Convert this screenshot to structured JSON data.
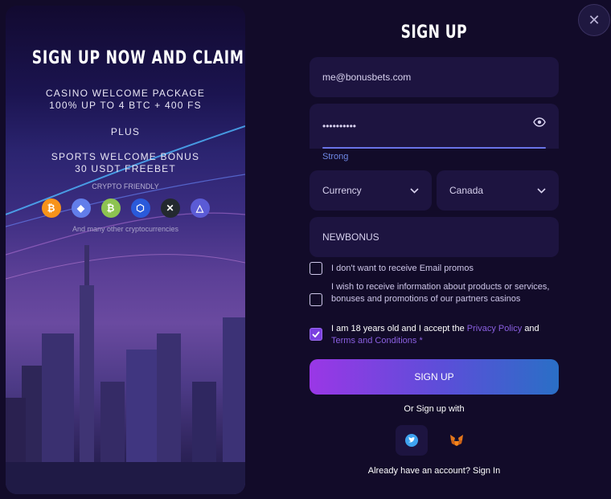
{
  "promo": {
    "title": "SIGN UP NOW AND CLAIM",
    "casino_line1": "CASINO WELCOME PACKAGE",
    "casino_line2": "100% UP TO 4 BTC + 400 FS",
    "plus": "PLUS",
    "sports_line1": "SPORTS WELCOME BONUS",
    "sports_line2": "30 USDT FREEBET",
    "crypto_friendly": "CRYPTO FRIENDLY",
    "coins": [
      {
        "name": "bitcoin-icon",
        "glyph": "₿",
        "color": "#f7931a"
      },
      {
        "name": "ethereum-icon",
        "glyph": "◆",
        "color": "#627eea"
      },
      {
        "name": "bitcoin-cash-icon",
        "glyph": "₿",
        "color": "#8dc351"
      },
      {
        "name": "chainlink-icon",
        "glyph": "⬡",
        "color": "#2a5ada"
      },
      {
        "name": "xrp-icon",
        "glyph": "✕",
        "color": "#23292f"
      },
      {
        "name": "tron-triangle-icon",
        "glyph": "△",
        "color": "#5b5bd6"
      }
    ],
    "many_others": "And many other cryptocurrencies"
  },
  "form": {
    "title": "SIGN UP",
    "email_value": "me@bonusbets.com",
    "password_value": "••••••••••",
    "password_strength": "Strong",
    "currency_placeholder": "Currency",
    "country_value": "Canada",
    "promo_code_value": "NEWBONUS",
    "checkbox_no_email": "I don't want to receive Email promos",
    "checkbox_partners": "I wish to receive information about products or services, bonuses and promotions of our partners casinos",
    "checkbox_age_prefix": "I am 18 years old and I accept the",
    "privacy_policy": "Privacy Policy",
    "and": "and",
    "terms": "Terms and Conditions",
    "required_mark": "*",
    "signup_button": "SIGN UP",
    "or_sign_up_with": "Or Sign up with",
    "already_account": "Already have an account? Sign In"
  },
  "colors": {
    "background": "#120b29",
    "field": "#1d1440",
    "accent_purple": "#9a37e6",
    "accent_blue": "#2a6fc6",
    "link": "#8a5fe0",
    "strength": "#6f88e6"
  }
}
